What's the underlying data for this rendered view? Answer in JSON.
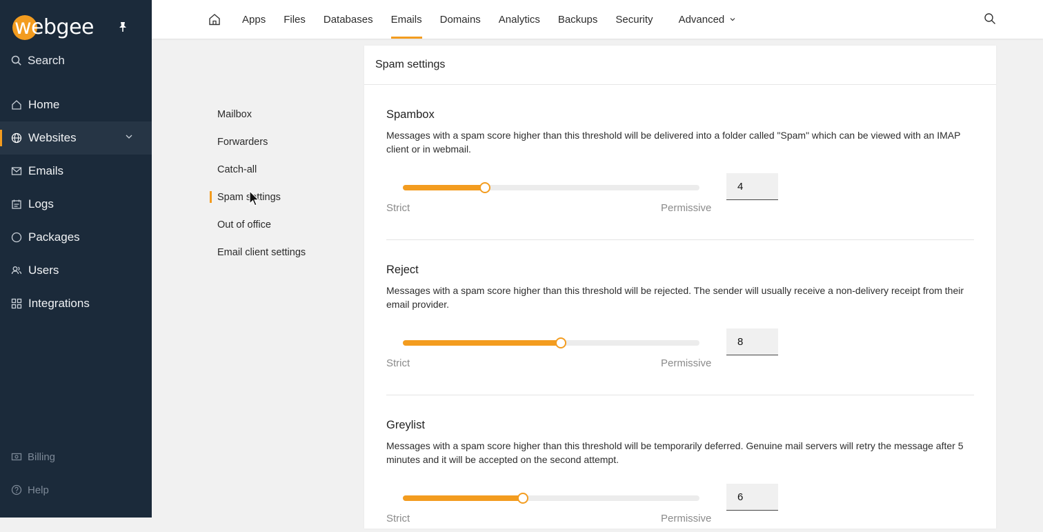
{
  "app": {
    "logo_text": "webgee",
    "brand_color": "#f39c1f"
  },
  "sidebar": {
    "search_label": "Search",
    "items": [
      {
        "label": "Home",
        "icon": "home-icon"
      },
      {
        "label": "Websites",
        "icon": "globe-icon",
        "active": true
      },
      {
        "label": "Emails",
        "icon": "mail-icon"
      },
      {
        "label": "Logs",
        "icon": "logs-icon"
      },
      {
        "label": "Packages",
        "icon": "packages-icon"
      },
      {
        "label": "Users",
        "icon": "users-icon"
      },
      {
        "label": "Integrations",
        "icon": "integrations-icon"
      }
    ],
    "bottom": [
      {
        "label": "Billing",
        "icon": "billing-icon"
      },
      {
        "label": "Help",
        "icon": "help-icon"
      }
    ]
  },
  "topnav": {
    "tabs": [
      "Apps",
      "Files",
      "Databases",
      "Emails",
      "Domains",
      "Analytics",
      "Backups",
      "Security",
      "Advanced"
    ],
    "active": "Emails"
  },
  "subnav": {
    "items": [
      "Mailbox",
      "Forwarders",
      "Catch-all",
      "Spam settings",
      "Out of office",
      "Email client settings"
    ],
    "active": "Spam settings"
  },
  "panel": {
    "title": "Spam settings",
    "sections": [
      {
        "title": "Spambox",
        "description": "Messages with a spam score higher than this threshold will be delivered into a folder called \"Spam\" which can be viewed with an IMAP client or in webmail.",
        "value": "4",
        "slider_fraction": 0.276,
        "min_label": "Strict",
        "max_label": "Permissive"
      },
      {
        "title": "Reject",
        "description": "Messages with a spam score higher than this threshold will be rejected. The sender will usually receive a non-delivery receipt from their email provider.",
        "value": "8",
        "slider_fraction": 0.532,
        "min_label": "Strict",
        "max_label": "Permissive"
      },
      {
        "title": "Greylist",
        "description": "Messages with a spam score higher than this threshold will be temporarily deferred. Genuine mail servers will retry the message after 5 minutes and it will be accepted on the second attempt.",
        "value": "6",
        "slider_fraction": 0.404,
        "min_label": "Strict",
        "max_label": "Permissive"
      }
    ]
  }
}
